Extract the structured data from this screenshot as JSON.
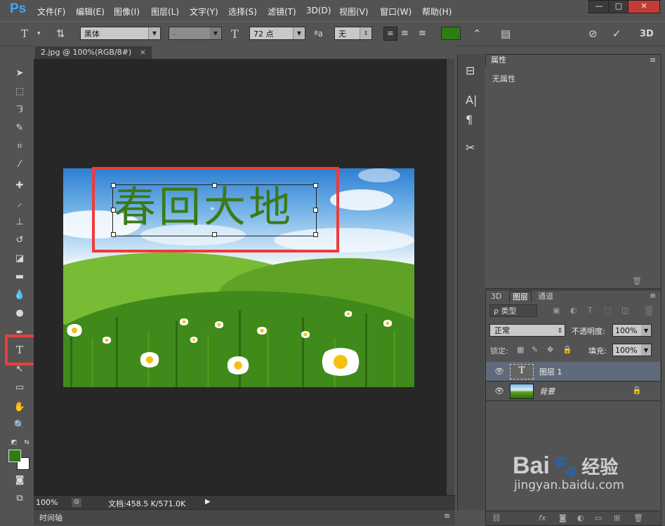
{
  "app": {
    "logo": "Ps"
  },
  "menu": [
    "文件(F)",
    "编辑(E)",
    "图像(I)",
    "图层(L)",
    "文字(Y)",
    "选择(S)",
    "滤镜(T)",
    "3D(D)",
    "视图(V)",
    "窗口(W)",
    "帮助(H)"
  ],
  "window_controls": {
    "minimize": "—",
    "maximize": "□",
    "close": "✕"
  },
  "options_bar": {
    "font_family": "黑体",
    "font_style": "-",
    "font_size": "72 点",
    "antialias_label": "ªa",
    "antialias": "无",
    "color": "#2e7d12",
    "mode_3d": "3D"
  },
  "document": {
    "tab_title": "2.jpg @ 100%(RGB/8#)",
    "headline": "春回大地",
    "zoom": "100%",
    "doc_size": "文档:458.5 K/571.0K",
    "timeline_label": "时间轴"
  },
  "colors": {
    "foreground": "#2e7d12",
    "background": "#ffffff",
    "highlight": "#ee3b3b"
  },
  "properties_panel": {
    "title": "属性",
    "empty_text": "无属性"
  },
  "layers_panel": {
    "tabs": [
      "3D",
      "图层",
      "通道"
    ],
    "active_tab": "图层",
    "filter_label": "ρ 类型",
    "blend_mode": "正常",
    "opacity_label": "不透明度:",
    "opacity": "100%",
    "lock_label": "锁定:",
    "fill_label": "填充:",
    "fill": "100%",
    "layers": [
      {
        "name": "图层 1",
        "type": "text",
        "selected": true
      },
      {
        "name": "背景",
        "type": "image",
        "locked": true
      }
    ]
  },
  "watermark": {
    "brand": "Bai",
    "brand2": "经验",
    "url": "jingyan.baidu.com"
  }
}
